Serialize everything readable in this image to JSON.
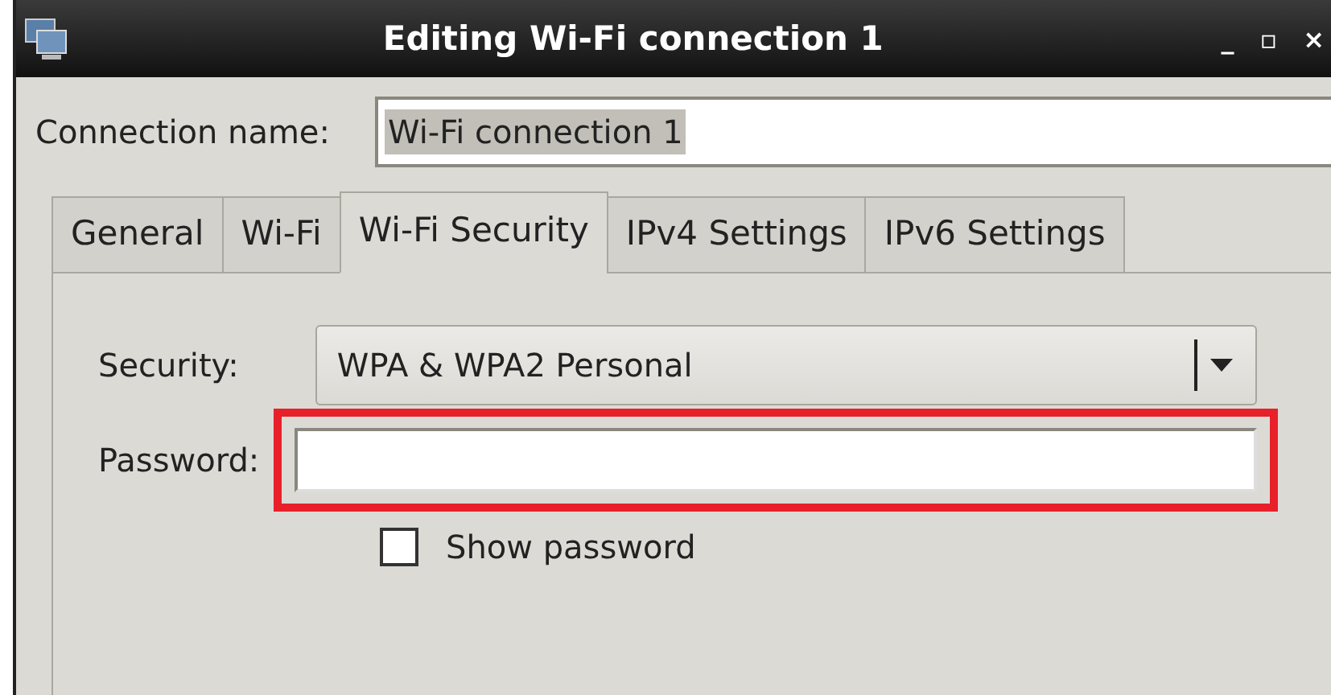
{
  "window": {
    "title": "Editing Wi-Fi connection 1",
    "controls": [
      "_",
      "▫",
      "×"
    ]
  },
  "connection_name": {
    "label": "Connection name:",
    "value": "Wi-Fi connection 1",
    "value_selected": true
  },
  "tabs": [
    {
      "label": "General",
      "selected": false
    },
    {
      "label": "Wi-Fi",
      "selected": false
    },
    {
      "label": "Wi-Fi Security",
      "selected": true
    },
    {
      "label": "IPv4 Settings",
      "selected": false
    },
    {
      "label": "IPv6 Settings",
      "selected": false
    }
  ],
  "security": {
    "label": "Security:",
    "value": "WPA & WPA2 Personal"
  },
  "password": {
    "label": "Password:",
    "highlighted": true
  },
  "show_password": {
    "label": "Show password",
    "checked": false
  }
}
